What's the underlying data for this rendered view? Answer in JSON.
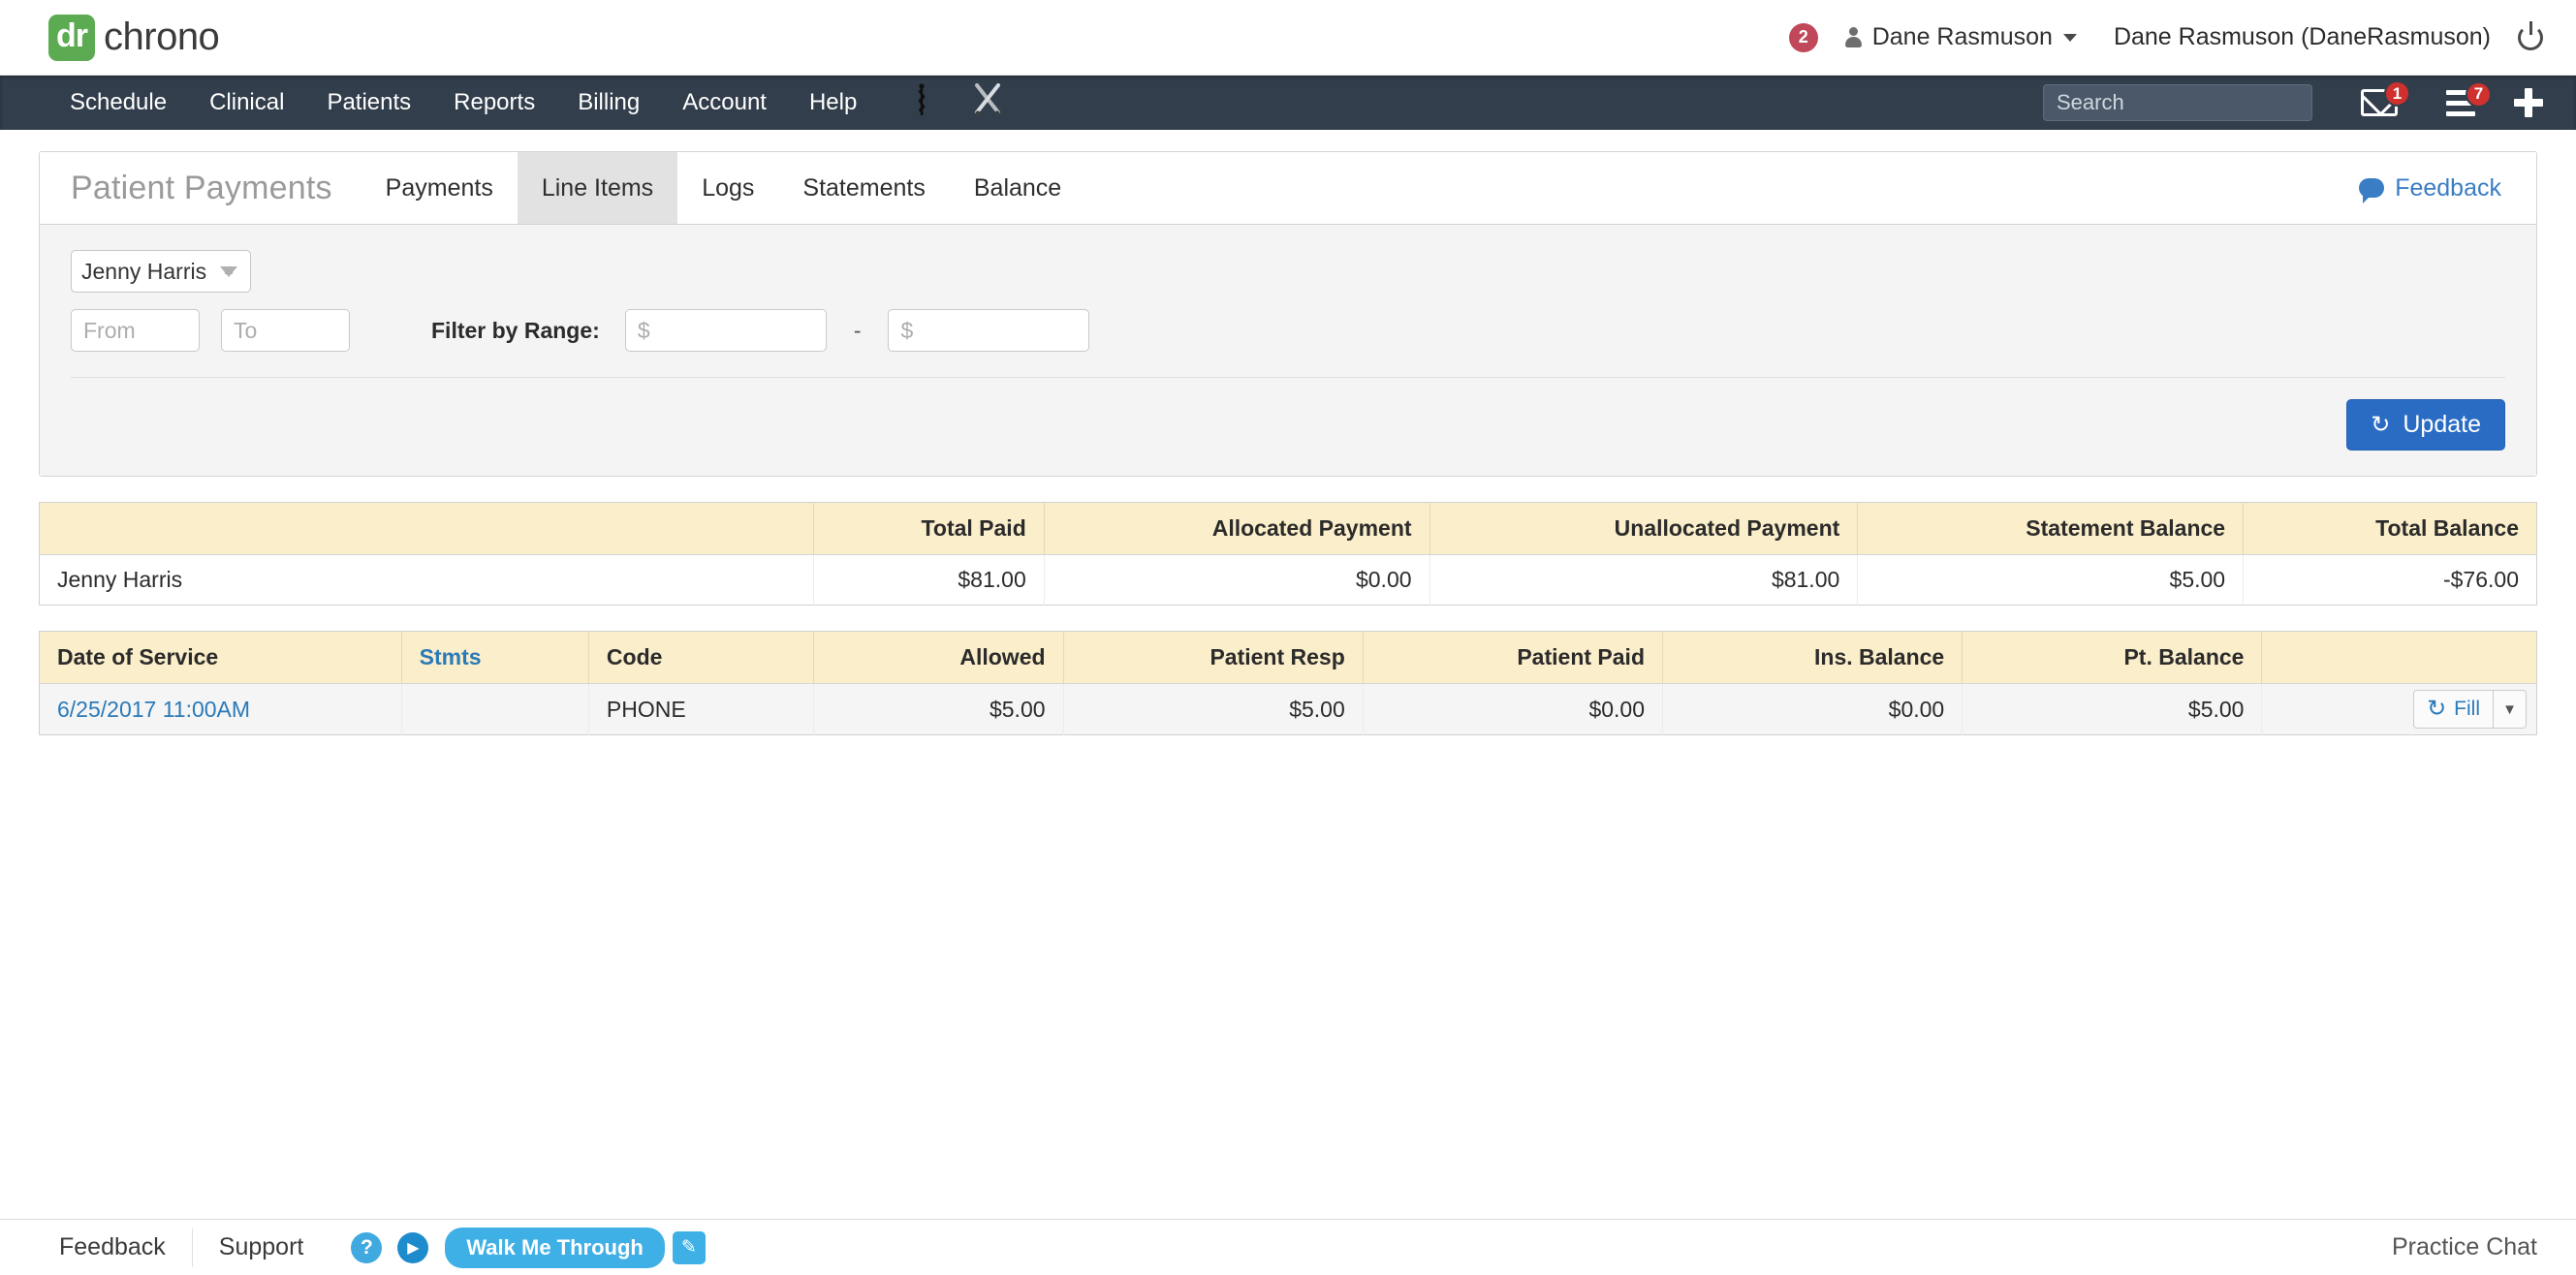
{
  "topbar": {
    "logo_mark": "dr",
    "logo_text": "chrono",
    "notification_count": "2",
    "user_menu_label": "Dane Rasmuson",
    "user_full_label": "Dane Rasmuson (DaneRasmuson)",
    "icons": {
      "person": "person-icon",
      "caret": "chevron-down-icon",
      "power": "power-icon"
    }
  },
  "nav": {
    "items": [
      {
        "label": "Schedule"
      },
      {
        "label": "Clinical"
      },
      {
        "label": "Patients"
      },
      {
        "label": "Reports"
      },
      {
        "label": "Billing"
      },
      {
        "label": "Account"
      },
      {
        "label": "Help"
      }
    ],
    "icons": [
      {
        "name": "caduceus-icon",
        "glyph": "⚕"
      },
      {
        "name": "crossed-tools-icon",
        "glyph": "⚔"
      }
    ],
    "search_placeholder": "Search",
    "search_value": "",
    "mail_badge": "1",
    "menu_badge": "7"
  },
  "panel": {
    "title": "Patient Payments",
    "tabs": [
      {
        "label": "Payments",
        "active": false
      },
      {
        "label": "Line Items",
        "active": true
      },
      {
        "label": "Logs",
        "active": false
      },
      {
        "label": "Statements",
        "active": false
      },
      {
        "label": "Balance",
        "active": false
      }
    ],
    "feedback_label": "Feedback"
  },
  "filters": {
    "patient_selected": "Jenny Harris",
    "from_placeholder": "From",
    "from_value": "",
    "to_placeholder": "To",
    "to_value": "",
    "range_label": "Filter by Range:",
    "range_min_placeholder": "$",
    "range_min_value": "",
    "range_dash": "-",
    "range_max_placeholder": "$",
    "range_max_value": "",
    "update_label": "Update"
  },
  "summary_table": {
    "headers": [
      "",
      "Total Paid",
      "Allocated Payment",
      "Unallocated Payment",
      "Statement Balance",
      "Total Balance"
    ],
    "rows": [
      {
        "name": "Jenny Harris",
        "total_paid": "$81.00",
        "allocated_payment": "$0.00",
        "unallocated_payment": "$81.00",
        "statement_balance": "$5.00",
        "total_balance": "-$76.00"
      }
    ]
  },
  "line_items_table": {
    "headers": [
      "Date of Service",
      "Stmts",
      "Code",
      "Allowed",
      "Patient Resp",
      "Patient Paid",
      "Ins. Balance",
      "Pt. Balance",
      ""
    ],
    "rows": [
      {
        "date_of_service": "6/25/2017 11:00AM",
        "stmts": "",
        "code": "PHONE",
        "allowed": "$5.00",
        "patient_resp": "$5.00",
        "patient_paid": "$0.00",
        "ins_balance": "$0.00",
        "pt_balance": "$5.00",
        "fill_label": "Fill"
      }
    ]
  },
  "footer": {
    "feedback_label": "Feedback",
    "support_label": "Support",
    "help_glyph": "?",
    "play_glyph": "▶",
    "walk_me_through_label": "Walk Me Through",
    "pencil_glyph": "✎",
    "practice_chat_label": "Practice Chat"
  },
  "colors": {
    "nav_bg": "#323e4b",
    "brand_green": "#5cab52",
    "table_header": "#fbeeca",
    "link_blue": "#2a7ab9",
    "button_blue": "#2a6cc4",
    "badge_red": "#d0312e"
  }
}
